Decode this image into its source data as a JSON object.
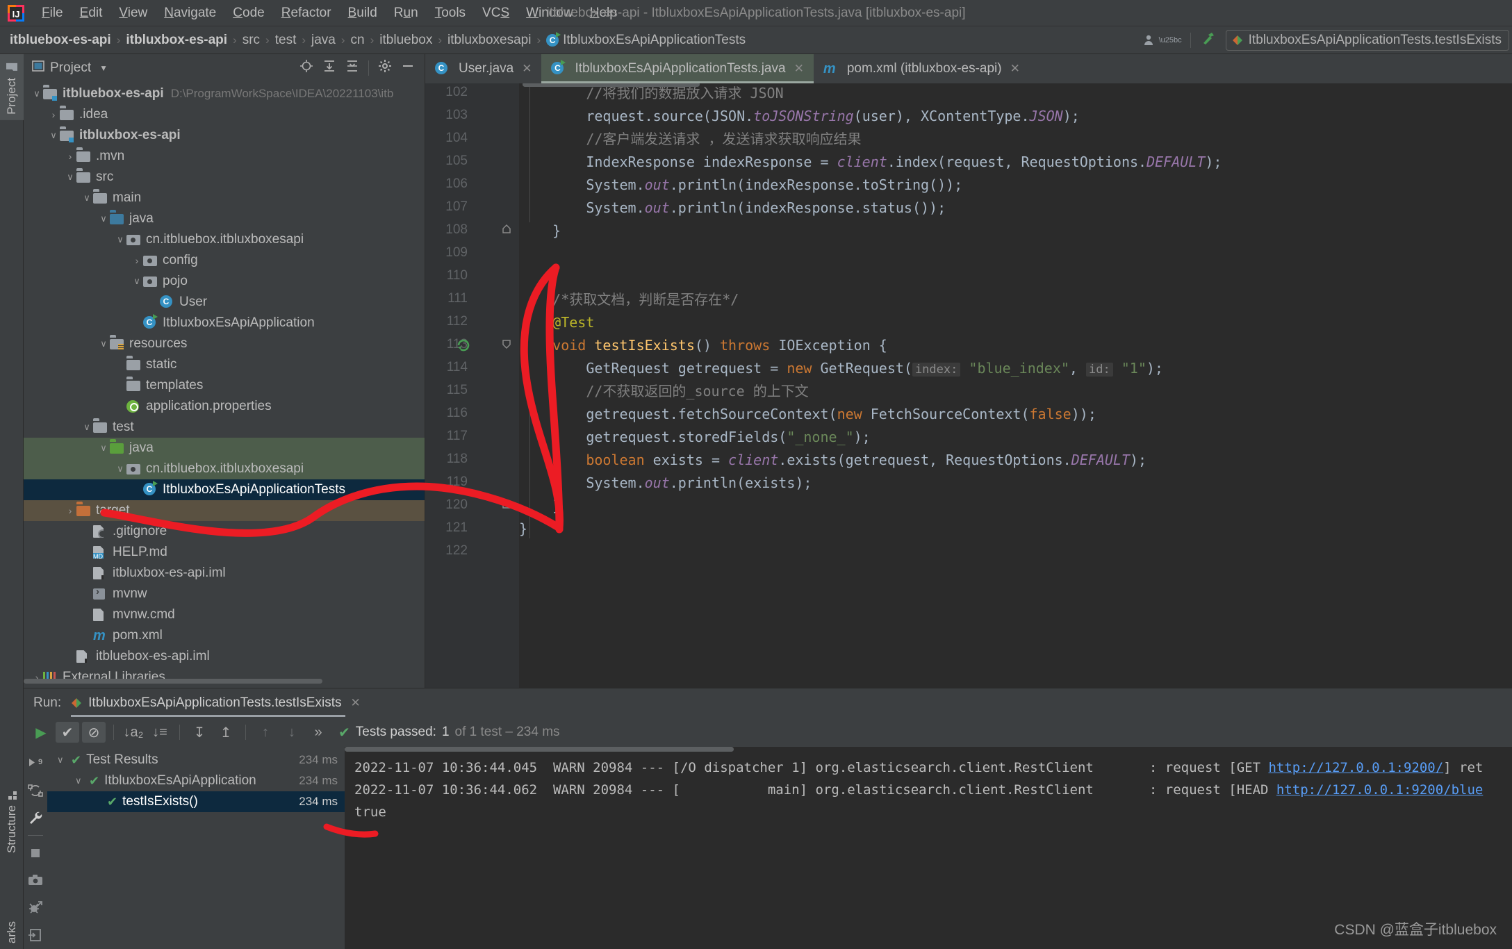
{
  "window": {
    "title": "itbluebox-es-api - ItbluxboxEsApiApplicationTests.java [itbluxbox-es-api]",
    "logo_name": "intellij-idea-logo"
  },
  "menu": [
    {
      "label": "File",
      "mnemonic": "F"
    },
    {
      "label": "Edit",
      "mnemonic": "E"
    },
    {
      "label": "View",
      "mnemonic": "V"
    },
    {
      "label": "Navigate",
      "mnemonic": "N"
    },
    {
      "label": "Code",
      "mnemonic": "C"
    },
    {
      "label": "Refactor",
      "mnemonic": "R"
    },
    {
      "label": "Build",
      "mnemonic": "B"
    },
    {
      "label": "Run",
      "mnemonic": "u"
    },
    {
      "label": "Tools",
      "mnemonic": "T"
    },
    {
      "label": "VCS",
      "mnemonic": "S"
    },
    {
      "label": "Window",
      "mnemonic": "W"
    },
    {
      "label": "Help",
      "mnemonic": "H"
    }
  ],
  "breadcrumb": {
    "items": [
      {
        "label": "itbluebox-es-api",
        "bold": true
      },
      {
        "label": "itbluxbox-es-api",
        "bold": true
      },
      {
        "label": "src",
        "bold": false
      },
      {
        "label": "test",
        "bold": false
      },
      {
        "label": "java",
        "bold": false
      },
      {
        "label": "cn",
        "bold": false
      },
      {
        "label": "itbluebox",
        "bold": false
      },
      {
        "label": "itbluxboxesapi",
        "bold": false
      },
      {
        "label": "ItbluxboxEsApiApplicationTests",
        "bold": false,
        "icon": "class-icon"
      }
    ],
    "separator": "›"
  },
  "toolbar_right": {
    "account_icon": "user-account-icon",
    "hammer_icon": "build-hammer-icon",
    "run_configuration": "ItbluxboxEsApiApplicationTests.testIsExists"
  },
  "left_strip": {
    "project_tab": "Project",
    "structure_tab": "Structure",
    "bookmarks_tab": "arks"
  },
  "project_panel": {
    "title": "Project",
    "tools": [
      "locate-icon",
      "expand-all-icon",
      "collapse-all-icon",
      "settings-gear-icon",
      "hide-icon"
    ],
    "tree": [
      {
        "indent": 0,
        "arrow": "⌄",
        "icon": "folder-module",
        "label": "itbluebox-es-api",
        "bold": true,
        "path": "D:\\ProgramWorkSpace\\IDEA\\20221103\\itb",
        "state": "none"
      },
      {
        "indent": 1,
        "arrow": "›",
        "icon": "folder",
        "label": ".idea",
        "bold": false,
        "path": "",
        "state": "none"
      },
      {
        "indent": 1,
        "arrow": "⌄",
        "icon": "folder-module",
        "label": "itbluxbox-es-api",
        "bold": true,
        "path": "",
        "state": "none"
      },
      {
        "indent": 2,
        "arrow": "›",
        "icon": "folder",
        "label": ".mvn",
        "bold": false,
        "path": "",
        "state": "none"
      },
      {
        "indent": 2,
        "arrow": "⌄",
        "icon": "folder",
        "label": "src",
        "bold": false,
        "path": "",
        "state": "none"
      },
      {
        "indent": 3,
        "arrow": "⌄",
        "icon": "folder",
        "label": "main",
        "bold": false,
        "path": "",
        "state": "none"
      },
      {
        "indent": 4,
        "arrow": "⌄",
        "icon": "folder-source",
        "label": "java",
        "bold": false,
        "path": "",
        "state": "none"
      },
      {
        "indent": 5,
        "arrow": "⌄",
        "icon": "package",
        "label": "cn.itbluebox.itbluxboxesapi",
        "bold": false,
        "path": "",
        "state": "none"
      },
      {
        "indent": 6,
        "arrow": "›",
        "icon": "package",
        "label": "config",
        "bold": false,
        "path": "",
        "state": "none"
      },
      {
        "indent": 6,
        "arrow": "⌄",
        "icon": "package",
        "label": "pojo",
        "bold": false,
        "path": "",
        "state": "none"
      },
      {
        "indent": 7,
        "arrow": "",
        "icon": "class-icon",
        "label": "User",
        "bold": false,
        "path": "",
        "state": "none"
      },
      {
        "indent": 6,
        "arrow": "",
        "icon": "class-run-icon",
        "label": "ItbluxboxEsApiApplication",
        "bold": false,
        "path": "",
        "state": "none"
      },
      {
        "indent": 4,
        "arrow": "⌄",
        "icon": "folder-resources",
        "label": "resources",
        "bold": false,
        "path": "",
        "state": "none"
      },
      {
        "indent": 5,
        "arrow": "",
        "icon": "folder",
        "label": "static",
        "bold": false,
        "path": "",
        "state": "none"
      },
      {
        "indent": 5,
        "arrow": "",
        "icon": "folder",
        "label": "templates",
        "bold": false,
        "path": "",
        "state": "none"
      },
      {
        "indent": 5,
        "arrow": "",
        "icon": "spring-properties-icon",
        "label": "application.properties",
        "bold": false,
        "path": "",
        "state": "none"
      },
      {
        "indent": 3,
        "arrow": "⌄",
        "icon": "folder",
        "label": "test",
        "bold": false,
        "path": "",
        "state": "none"
      },
      {
        "indent": 4,
        "arrow": "⌄",
        "icon": "folder-test-source",
        "label": "java",
        "bold": false,
        "path": "",
        "state": "highlight-green"
      },
      {
        "indent": 5,
        "arrow": "⌄",
        "icon": "package",
        "label": "cn.itbluebox.itbluxboxesapi",
        "bold": false,
        "path": "",
        "state": "highlight-green"
      },
      {
        "indent": 6,
        "arrow": "",
        "icon": "class-run-icon",
        "label": "ItbluxboxEsApiApplicationTests",
        "bold": false,
        "path": "",
        "state": "selected"
      },
      {
        "indent": 2,
        "arrow": "›",
        "icon": "folder-excluded",
        "label": "target",
        "bold": false,
        "path": "",
        "state": "highlight-tan"
      },
      {
        "indent": 3,
        "arrow": "",
        "icon": "file-ignored",
        "label": ".gitignore",
        "bold": false,
        "path": "",
        "state": "none"
      },
      {
        "indent": 3,
        "arrow": "",
        "icon": "file-markdown",
        "label": "HELP.md",
        "bold": false,
        "path": "",
        "state": "none"
      },
      {
        "indent": 3,
        "arrow": "",
        "icon": "file-iml",
        "label": "itbluxbox-es-api.iml",
        "bold": false,
        "path": "",
        "state": "none"
      },
      {
        "indent": 3,
        "arrow": "",
        "icon": "file-shell",
        "label": "mvnw",
        "bold": false,
        "path": "",
        "state": "none"
      },
      {
        "indent": 3,
        "arrow": "",
        "icon": "file-text",
        "label": "mvnw.cmd",
        "bold": false,
        "path": "",
        "state": "none"
      },
      {
        "indent": 3,
        "arrow": "",
        "icon": "maven-icon",
        "label": "pom.xml",
        "bold": false,
        "path": "",
        "state": "none"
      },
      {
        "indent": 2,
        "arrow": "",
        "icon": "file-iml",
        "label": "itbluebox-es-api.iml",
        "bold": false,
        "path": "",
        "state": "none"
      },
      {
        "indent": 0,
        "arrow": "›",
        "icon": "external-libraries-icon",
        "label": "External Libraries",
        "bold": false,
        "path": "",
        "state": "none"
      }
    ]
  },
  "editor": {
    "tabs": [
      {
        "label": "User.java",
        "icon": "class-icon",
        "active": false
      },
      {
        "label": "ItbluxboxEsApiApplicationTests.java",
        "icon": "class-run-icon",
        "active": true
      },
      {
        "label": "pom.xml (itbluxbox-es-api)",
        "icon": "maven-icon",
        "active": false
      }
    ],
    "first_line_number": 102,
    "lines": [
      {
        "n": 102,
        "fold": "",
        "gutter_icon": "",
        "tokens": [
          {
            "t": "        ",
            "c": "txt"
          },
          {
            "t": "//将我们的数据放入请求 JSON",
            "c": "cmt"
          }
        ]
      },
      {
        "n": 103,
        "fold": "",
        "gutter_icon": "",
        "tokens": [
          {
            "t": "        request.source(JSON.",
            "c": "txt"
          },
          {
            "t": "toJSONString",
            "c": "fld"
          },
          {
            "t": "(user), XContentType.",
            "c": "txt"
          },
          {
            "t": "JSON",
            "c": "fld"
          },
          {
            "t": ");",
            "c": "txt"
          }
        ]
      },
      {
        "n": 104,
        "fold": "",
        "gutter_icon": "",
        "tokens": [
          {
            "t": "        ",
            "c": "txt"
          },
          {
            "t": "//客户端发送请求 ，发送请求获取响应结果",
            "c": "cmt"
          }
        ]
      },
      {
        "n": 105,
        "fold": "",
        "gutter_icon": "",
        "tokens": [
          {
            "t": "        IndexResponse indexResponse = ",
            "c": "txt"
          },
          {
            "t": "client",
            "c": "fld"
          },
          {
            "t": ".index(request, RequestOptions.",
            "c": "txt"
          },
          {
            "t": "DEFAULT",
            "c": "fld"
          },
          {
            "t": ");",
            "c": "txt"
          }
        ]
      },
      {
        "n": 106,
        "fold": "",
        "gutter_icon": "",
        "tokens": [
          {
            "t": "        System.",
            "c": "txt"
          },
          {
            "t": "out",
            "c": "fld"
          },
          {
            "t": ".println(indexResponse.toString());",
            "c": "txt"
          }
        ]
      },
      {
        "n": 107,
        "fold": "",
        "gutter_icon": "",
        "tokens": [
          {
            "t": "        System.",
            "c": "txt"
          },
          {
            "t": "out",
            "c": "fld"
          },
          {
            "t": ".println(indexResponse.status());",
            "c": "txt"
          }
        ]
      },
      {
        "n": 108,
        "fold": "end",
        "gutter_icon": "",
        "tokens": [
          {
            "t": "    }",
            "c": "txt"
          }
        ]
      },
      {
        "n": 109,
        "fold": "",
        "gutter_icon": "",
        "tokens": []
      },
      {
        "n": 110,
        "fold": "",
        "gutter_icon": "",
        "tokens": []
      },
      {
        "n": 111,
        "fold": "",
        "gutter_icon": "",
        "tokens": [
          {
            "t": "    ",
            "c": "txt"
          },
          {
            "t": "/*获取文档，判断是否存在*/",
            "c": "cmt"
          }
        ]
      },
      {
        "n": 112,
        "fold": "",
        "gutter_icon": "",
        "tokens": [
          {
            "t": "    ",
            "c": "txt"
          },
          {
            "t": "@Test",
            "c": "ann"
          }
        ]
      },
      {
        "n": 113,
        "fold": "start",
        "gutter_icon": "run-test-icon",
        "tokens": [
          {
            "t": "    ",
            "c": "txt"
          },
          {
            "t": "void ",
            "c": "kw"
          },
          {
            "t": "testIsExists",
            "c": "mth"
          },
          {
            "t": "() ",
            "c": "txt"
          },
          {
            "t": "throws ",
            "c": "kw"
          },
          {
            "t": "IOException {",
            "c": "txt"
          }
        ]
      },
      {
        "n": 114,
        "fold": "",
        "gutter_icon": "",
        "tokens": [
          {
            "t": "        GetRequest getrequest = ",
            "c": "txt"
          },
          {
            "t": "new ",
            "c": "kw"
          },
          {
            "t": "GetRequest(",
            "c": "txt"
          },
          {
            "t": "index:",
            "c": "hint"
          },
          {
            "t": " ",
            "c": "txt"
          },
          {
            "t": "\"blue_index\"",
            "c": "str"
          },
          {
            "t": ", ",
            "c": "txt"
          },
          {
            "t": "id:",
            "c": "hint"
          },
          {
            "t": " ",
            "c": "txt"
          },
          {
            "t": "\"1\"",
            "c": "str"
          },
          {
            "t": ");",
            "c": "txt"
          }
        ]
      },
      {
        "n": 115,
        "fold": "",
        "gutter_icon": "",
        "tokens": [
          {
            "t": "        ",
            "c": "txt"
          },
          {
            "t": "//不获取返回的_source 的上下文",
            "c": "cmt"
          }
        ]
      },
      {
        "n": 116,
        "fold": "",
        "gutter_icon": "",
        "tokens": [
          {
            "t": "        getrequest.fetchSourceContext(",
            "c": "txt"
          },
          {
            "t": "new ",
            "c": "kw"
          },
          {
            "t": "FetchSourceContext(",
            "c": "txt"
          },
          {
            "t": "false",
            "c": "kw"
          },
          {
            "t": "));",
            "c": "txt"
          }
        ]
      },
      {
        "n": 117,
        "fold": "",
        "gutter_icon": "",
        "tokens": [
          {
            "t": "        getrequest.storedFields(",
            "c": "txt"
          },
          {
            "t": "\"_none_\"",
            "c": "str"
          },
          {
            "t": ");",
            "c": "txt"
          }
        ]
      },
      {
        "n": 118,
        "fold": "",
        "gutter_icon": "",
        "tokens": [
          {
            "t": "        ",
            "c": "txt"
          },
          {
            "t": "boolean ",
            "c": "kw"
          },
          {
            "t": "exists = ",
            "c": "txt"
          },
          {
            "t": "client",
            "c": "fld"
          },
          {
            "t": ".exists(getrequest, RequestOptions.",
            "c": "txt"
          },
          {
            "t": "DEFAULT",
            "c": "fld"
          },
          {
            "t": ");",
            "c": "txt"
          }
        ]
      },
      {
        "n": 119,
        "fold": "",
        "gutter_icon": "",
        "tokens": [
          {
            "t": "        System.",
            "c": "txt"
          },
          {
            "t": "out",
            "c": "fld"
          },
          {
            "t": ".println(exists);",
            "c": "txt"
          }
        ]
      },
      {
        "n": 120,
        "fold": "end",
        "gutter_icon": "",
        "tokens": [
          {
            "t": "    }",
            "c": "txt"
          }
        ]
      },
      {
        "n": 121,
        "fold": "",
        "gutter_icon": "",
        "tokens": [
          {
            "t": "}",
            "c": "txt"
          }
        ]
      },
      {
        "n": 122,
        "fold": "",
        "gutter_icon": "",
        "tokens": []
      }
    ]
  },
  "run_panel": {
    "label": "Run:",
    "tab_title": "ItbluxboxEsApiApplicationTests.testIsExists",
    "toolbar": [
      {
        "name": "rerun-button",
        "glyph": "▶",
        "color": "#499c54",
        "active": false
      },
      {
        "name": "show-passed-toggle",
        "glyph": "✔",
        "color": "#c0c0c0",
        "active": true
      },
      {
        "name": "show-ignored-toggle",
        "glyph": "⊘",
        "color": "#c0c0c0",
        "active": true
      },
      {
        "name": "sort-alphabetically-button",
        "glyph": "↓a₂",
        "color": "#a9a9a9",
        "active": false
      },
      {
        "name": "sort-by-duration-button",
        "glyph": "↓≡",
        "color": "#a9a9a9",
        "active": false
      },
      {
        "name": "expand-all-button",
        "glyph": "↧",
        "color": "#a9a9a9",
        "active": false
      },
      {
        "name": "collapse-all-button",
        "glyph": "↥",
        "color": "#a9a9a9",
        "active": false
      },
      {
        "name": "prev-failed-button",
        "glyph": "↑",
        "color": "#6f7275",
        "active": false
      },
      {
        "name": "next-failed-button",
        "glyph": "↓",
        "color": "#6f7275",
        "active": false
      },
      {
        "name": "more-options-button",
        "glyph": "»",
        "color": "#a9a9a9",
        "active": false
      }
    ],
    "status": {
      "prefix": "Tests passed:",
      "count": "1",
      "suffix": "of 1 test – 234 ms",
      "icon": "check-icon"
    },
    "side_icons": [
      "rerun-failed-icon",
      "toggle-auto-test-icon",
      "settings-wrench-icon",
      "stop-icon",
      "screenshot-icon",
      "mute-breakpoints-icon",
      "export-icon"
    ],
    "tests": [
      {
        "indent": 0,
        "arrow": "⌄",
        "label": "Test Results",
        "time": "234 ms",
        "selected": false
      },
      {
        "indent": 1,
        "arrow": "⌄",
        "label": "ItbluxboxEsApiApplication",
        "time": "234 ms",
        "selected": false
      },
      {
        "indent": 2,
        "arrow": "",
        "label": "testIsExists()",
        "time": "234 ms",
        "selected": true
      }
    ],
    "console": [
      {
        "segments": [
          {
            "text": "2022-11-07 10:36:44.045  WARN 20984 --- [/O dispatcher 1] org.elasticsearch.client.RestClient       : request [GET ",
            "link": false
          },
          {
            "text": "http://127.0.0.1:9200/",
            "link": true
          },
          {
            "text": "] ret",
            "link": false
          }
        ]
      },
      {
        "segments": [
          {
            "text": "2022-11-07 10:36:44.062  WARN 20984 --- [           main] org.elasticsearch.client.RestClient       : request [HEAD ",
            "link": false
          },
          {
            "text": "http://127.0.0.1:9200/blue",
            "link": true
          }
        ]
      },
      {
        "segments": [
          {
            "text": "true",
            "link": false
          }
        ]
      }
    ]
  },
  "watermark": "CSDN @蓝盒子itbluebox"
}
